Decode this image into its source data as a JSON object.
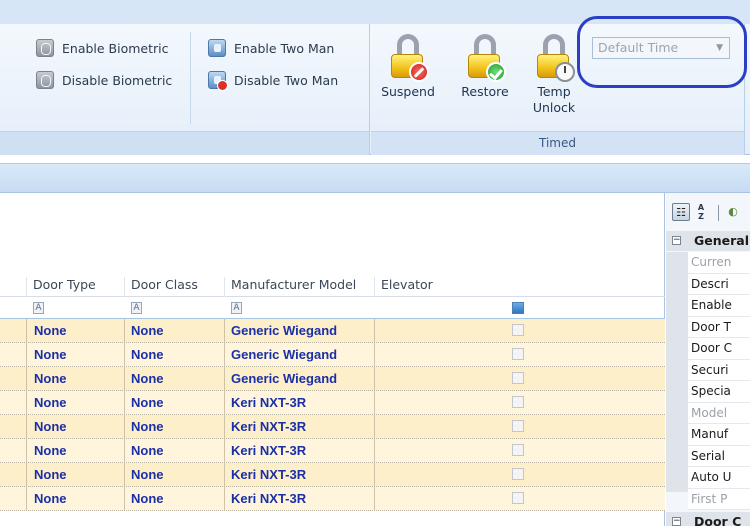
{
  "ribbon": {
    "biometric": {
      "enable_label": "Enable Biometric",
      "disable_label": "Disable Biometric"
    },
    "two_man": {
      "enable_label": "Enable Two Man",
      "disable_label": "Disable Two Man"
    },
    "timed": {
      "group_label": "Timed",
      "suspend_label": "Suspend",
      "restore_label": "Restore",
      "temp_unlock_label": "Temp\nUnlock",
      "time_select": {
        "value": "Default Time"
      }
    }
  },
  "grid": {
    "columns": [
      "Door Type",
      "Door Class",
      "Manufacturer Model",
      "Elevator"
    ],
    "filter_glyph": "A",
    "rows": [
      {
        "door_type": "None",
        "door_class": "None",
        "model": "Generic Wiegand",
        "elevator": false
      },
      {
        "door_type": "None",
        "door_class": "None",
        "model": "Generic Wiegand",
        "elevator": false
      },
      {
        "door_type": "None",
        "door_class": "None",
        "model": "Generic Wiegand",
        "elevator": false
      },
      {
        "door_type": "None",
        "door_class": "None",
        "model": "Keri NXT-3R",
        "elevator": false
      },
      {
        "door_type": "None",
        "door_class": "None",
        "model": "Keri NXT-3R",
        "elevator": false
      },
      {
        "door_type": "None",
        "door_class": "None",
        "model": "Keri NXT-3R",
        "elevator": false
      },
      {
        "door_type": "None",
        "door_class": "None",
        "model": "Keri NXT-3R",
        "elevator": false
      },
      {
        "door_type": "None",
        "door_class": "None",
        "model": "Keri NXT-3R",
        "elevator": false
      }
    ]
  },
  "properties": {
    "sort_glyph": "A Z",
    "category_general": "General",
    "category_door": "Door C",
    "items": [
      {
        "label": "Curren",
        "muted": true
      },
      {
        "label": "Descri",
        "muted": false
      },
      {
        "label": "Enable",
        "muted": false
      },
      {
        "label": "Door T",
        "muted": false
      },
      {
        "label": "Door C",
        "muted": false
      },
      {
        "label": "Securi",
        "muted": false
      },
      {
        "label": "Specia",
        "muted": false
      },
      {
        "label": "Model",
        "muted": true
      },
      {
        "label": "Manuf",
        "muted": false
      },
      {
        "label": "Serial",
        "muted": false
      },
      {
        "label": "Auto U",
        "muted": false
      },
      {
        "label": "First P",
        "muted": true
      }
    ]
  },
  "colors": {
    "accent_ring": "#2a3fc4",
    "row_text": "#1b2fa6",
    "row_bg": "#fdefc9"
  }
}
